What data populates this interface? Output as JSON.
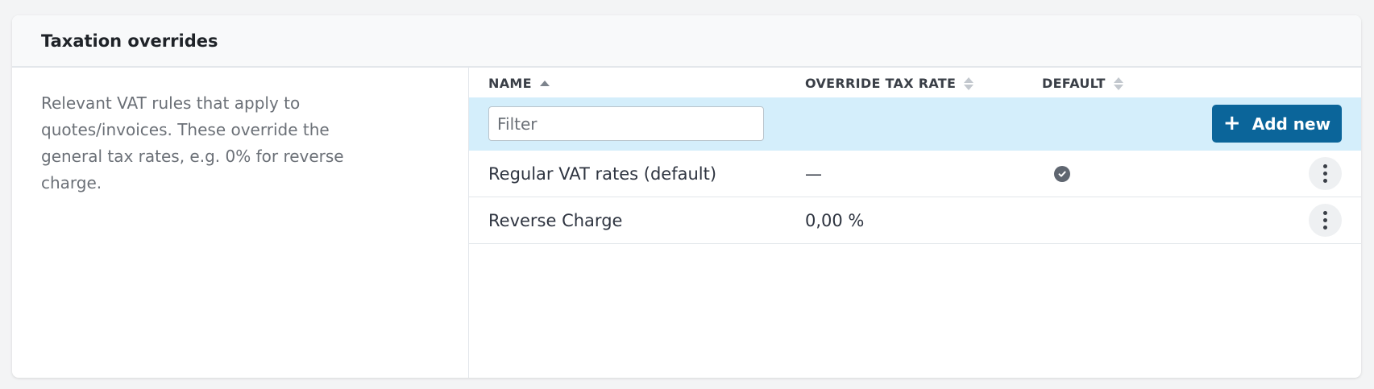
{
  "card": {
    "title": "Taxation overrides",
    "description": "Relevant VAT rules that apply to quotes/invoices. These override the general tax rates, e.g. 0% for reverse charge."
  },
  "table": {
    "columns": {
      "name": "NAME",
      "override_tax_rate": "OVERRIDE TAX RATE",
      "default": "DEFAULT"
    },
    "sort": {
      "column": "name",
      "direction": "ascending"
    },
    "filter": {
      "placeholder": "Filter",
      "value": ""
    },
    "add_button": {
      "icon": "+",
      "label": "Add new"
    },
    "rows": [
      {
        "name": "Regular VAT rates (default)",
        "rate": "—",
        "is_default": true
      },
      {
        "name": "Reverse Charge",
        "rate": "0,00 %",
        "is_default": false
      }
    ]
  },
  "colors": {
    "accent": "#0b659a",
    "filter_row_bg": "#d4eefb",
    "check_icon": "#5f6670"
  },
  "icons": [
    "sort-ascending-icon",
    "sort-icon",
    "plus-icon",
    "check-circle-icon",
    "kebab-menu-icon"
  ]
}
